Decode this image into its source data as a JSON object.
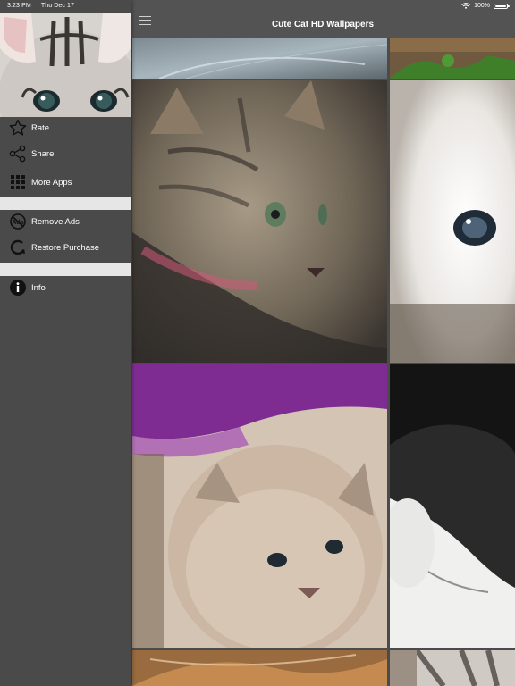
{
  "status_bar": {
    "time": "3:23 PM",
    "date": "Thu Dec 17",
    "battery": "100%"
  },
  "nav": {
    "title": "Cute Cat HD Wallpapers"
  },
  "drawer": {
    "items": [
      {
        "label": "Rate",
        "icon": "star-icon"
      },
      {
        "label": "Share",
        "icon": "share-icon"
      },
      {
        "label": "More Apps",
        "icon": "grid-icon"
      },
      {
        "label": "Remove Ads",
        "icon": "no-ads-icon"
      },
      {
        "label": "Restore Purchase",
        "icon": "restore-icon"
      },
      {
        "label": "Info",
        "icon": "info-icon"
      }
    ]
  },
  "wallpapers": [
    {
      "name": "blue-light-abstract"
    },
    {
      "name": "kitten-in-grass"
    },
    {
      "name": "tabby-kitten"
    },
    {
      "name": "white-persian-kitten"
    },
    {
      "name": "cream-scottish-fold-kitten"
    },
    {
      "name": "black-and-white-kitten"
    },
    {
      "name": "orange-kitten-partial"
    },
    {
      "name": "tabby-kitten-partial"
    }
  ],
  "colors": {
    "drawer_bg": "#4a4a4a",
    "nav_bg": "#535353",
    "separator": "#e6e6e6",
    "text": "#ffffff"
  }
}
